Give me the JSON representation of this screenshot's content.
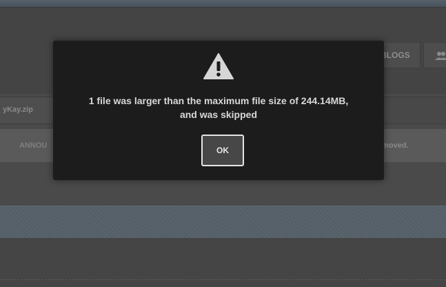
{
  "background": {
    "nav": {
      "blogs_label": "BLOGS",
      "people_icon": "people-icon"
    },
    "attachment": {
      "filename": "yKay.zip"
    },
    "announcement": {
      "left_text": "ANNOU",
      "right_text": "emoved."
    }
  },
  "dialog": {
    "icon": "warning-icon",
    "message_line1": "1 file was larger than the maximum file size of 244.14MB,",
    "message_line2": "and was skipped",
    "ok_label": "OK"
  },
  "colors": {
    "dialog_bg": "#1c1c1c",
    "overlay_page": "#4a4a4a",
    "button_bg": "#474747",
    "button_border": "#e6e6e6",
    "text": "#d8d8d8"
  }
}
